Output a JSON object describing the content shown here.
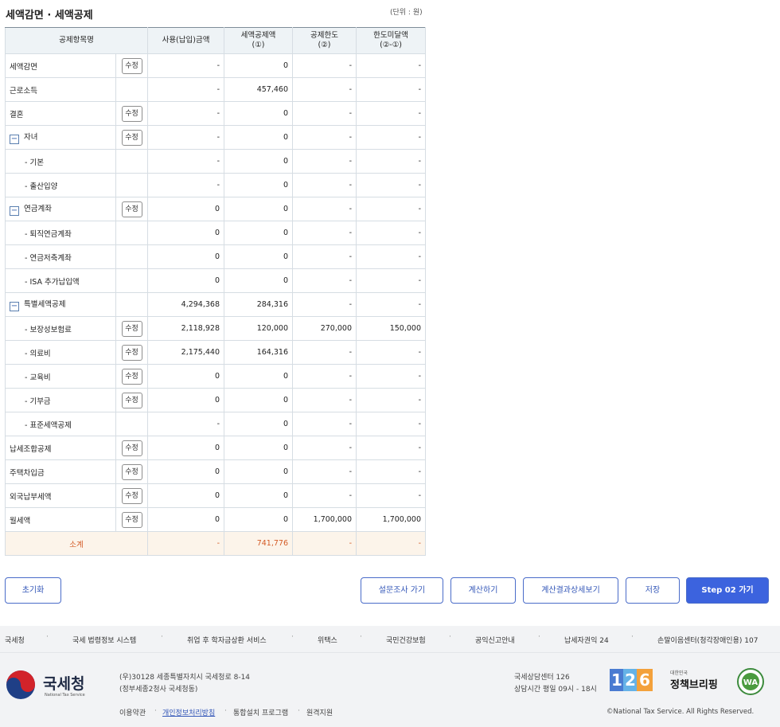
{
  "header": {
    "title": "세액감면 · 세액공제",
    "unit": "(단위 : 원)"
  },
  "table": {
    "columns": [
      "공제항목명",
      "사용(납입)금액",
      "세액공제액\n(①)",
      "공제한도\n(②)",
      "한도미달액\n(②-①)"
    ],
    "edit_label": "수정",
    "collapse_glyph": "−",
    "rows": [
      {
        "name": "세액감면",
        "edit": true,
        "used": "-",
        "credit": "0",
        "limit": "-",
        "short": "-"
      },
      {
        "name": "근로소득",
        "edit": false,
        "used": "-",
        "credit": "457,460",
        "limit": "-",
        "short": "-"
      },
      {
        "name": "결혼",
        "edit": true,
        "used": "-",
        "credit": "0",
        "limit": "-",
        "short": "-"
      },
      {
        "name": "자녀",
        "toggle": true,
        "edit": true,
        "used": "-",
        "credit": "0",
        "limit": "-",
        "short": "-"
      },
      {
        "name": "- 기본",
        "sub": true,
        "edit": false,
        "used": "-",
        "credit": "0",
        "limit": "-",
        "short": "-"
      },
      {
        "name": "- 출산입양",
        "sub": true,
        "edit": false,
        "used": "-",
        "credit": "0",
        "limit": "-",
        "short": "-"
      },
      {
        "name": "연금계좌",
        "toggle": true,
        "edit": true,
        "used": "0",
        "credit": "0",
        "limit": "-",
        "short": "-"
      },
      {
        "name": "- 퇴직연금계좌",
        "sub": true,
        "edit": false,
        "used": "0",
        "credit": "0",
        "limit": "-",
        "short": "-"
      },
      {
        "name": "- 연금저축계좌",
        "sub": true,
        "edit": false,
        "used": "0",
        "credit": "0",
        "limit": "-",
        "short": "-"
      },
      {
        "name": "- ISA 추가납입액",
        "sub": true,
        "edit": false,
        "used": "0",
        "credit": "0",
        "limit": "-",
        "short": "-"
      },
      {
        "name": "특별세액공제",
        "toggle": true,
        "edit": false,
        "used": "4,294,368",
        "credit": "284,316",
        "limit": "-",
        "short": "-"
      },
      {
        "name": "- 보장성보험료",
        "sub": true,
        "edit": true,
        "used": "2,118,928",
        "credit": "120,000",
        "limit": "270,000",
        "short": "150,000"
      },
      {
        "name": "- 의료비",
        "sub": true,
        "edit": true,
        "used": "2,175,440",
        "credit": "164,316",
        "limit": "-",
        "short": "-"
      },
      {
        "name": "- 교육비",
        "sub": true,
        "edit": true,
        "used": "0",
        "credit": "0",
        "limit": "-",
        "short": "-"
      },
      {
        "name": "- 기부금",
        "sub": true,
        "edit": true,
        "used": "0",
        "credit": "0",
        "limit": "-",
        "short": "-"
      },
      {
        "name": "- 표준세액공제",
        "sub": true,
        "edit": false,
        "used": "-",
        "credit": "0",
        "limit": "-",
        "short": "-"
      },
      {
        "name": "납세조합공제",
        "edit": true,
        "used": "0",
        "credit": "0",
        "limit": "-",
        "short": "-"
      },
      {
        "name": "주택차입금",
        "edit": true,
        "used": "0",
        "credit": "0",
        "limit": "-",
        "short": "-"
      },
      {
        "name": "외국납부세액",
        "edit": true,
        "used": "0",
        "credit": "0",
        "limit": "-",
        "short": "-"
      },
      {
        "name": "월세액",
        "edit": true,
        "used": "0",
        "credit": "0",
        "limit": "1,700,000",
        "short": "1,700,000"
      }
    ],
    "total": {
      "name": "소계",
      "used": "-",
      "credit": "741,776",
      "limit": "-",
      "short": "-"
    }
  },
  "buttons": {
    "reset": "초기화",
    "survey": "설문조사 가기",
    "calculate": "계산하기",
    "detail": "계산결과상세보기",
    "save": "저장",
    "next": "Step 02 가기"
  },
  "links": [
    "국세청",
    "국세 법령정보 시스템",
    "취업 후 학자금상환 서비스",
    "위택스",
    "국민건강보험",
    "공익신고안내",
    "납세자권익 24",
    "손말이음센터(청각장애인용) 107"
  ],
  "footer": {
    "logo_text": "국세청",
    "logo_sub": "National Tax Service",
    "address1": "(우)30128 세종특별자치시 국세청로 8-14",
    "address2": "(정부세종2청사 국세청동)",
    "bottom_links": [
      "이용약관",
      "개인정보처리방침",
      "통합설치 프로그램",
      "원격지원"
    ],
    "center_title": "국세상담센터 126",
    "center_hours": "상담시간 평일 09시 - 18시",
    "badge_126": "126",
    "policy_small": "대한민국",
    "policy_big": "정책브리핑",
    "wa_text": "WA",
    "copyright": "©National Tax Service. All Rights Reserved.",
    "accent": "#3c63de",
    "total_color": "#d35b26"
  }
}
